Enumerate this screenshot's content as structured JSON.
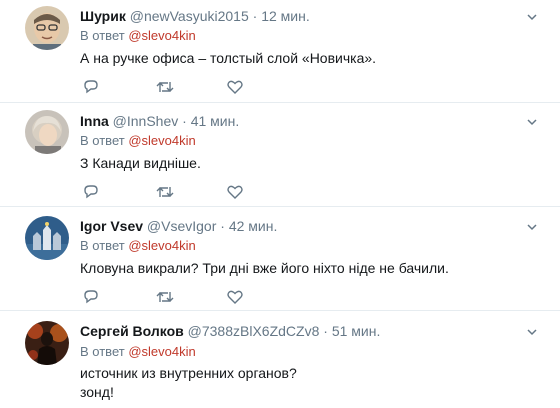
{
  "tweets": [
    {
      "name": "Шурик",
      "handle": "@newVasyuki2015",
      "dot": "·",
      "time": "12 мин.",
      "reply_prefix": "В ответ",
      "reply_to": "@slevo4kin",
      "text": "А на ручке офиса – толстый слой «Новичка».",
      "text_line2": ""
    },
    {
      "name": "Inna",
      "handle": "@InnShev",
      "dot": "·",
      "time": "41 мин.",
      "reply_prefix": "В ответ",
      "reply_to": "@slevo4kin",
      "text": "З Канади видніше.",
      "text_line2": ""
    },
    {
      "name": "Igor Vsev",
      "handle": "@VsevIgor",
      "dot": "·",
      "time": "42 мин.",
      "reply_prefix": "В ответ",
      "reply_to": "@slevo4kin",
      "text": "Кловуна викрали? Три дні вже його ніхто ніде не бачили.",
      "text_line2": ""
    },
    {
      "name": "Сергей Волков",
      "handle": "@7388zBlX6ZdCZv8",
      "dot": "·",
      "time": "51 мин.",
      "reply_prefix": "В ответ",
      "reply_to": "@slevo4kin",
      "text": "источник из внутренних органов?",
      "text_line2": "зонд!"
    }
  ],
  "icons": {
    "reply": "reply-icon",
    "retweet": "retweet-icon",
    "like": "heart-icon",
    "menu": "chevron-down-icon"
  },
  "colors": {
    "mention": "#c0392b",
    "secondary_text": "#657786",
    "icon": "#657786",
    "divider": "#e6ecf0"
  }
}
